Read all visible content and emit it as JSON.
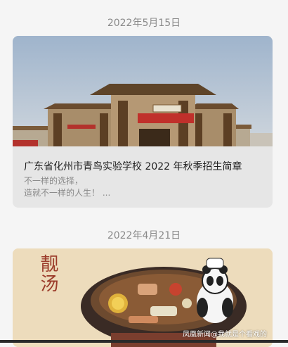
{
  "feed": {
    "items": [
      {
        "date": "2022年5月15日",
        "cover_icon": "school-gate-image",
        "title": "广东省化州市青鸟实验学校 2022 年秋季招生简章",
        "summary_lines": [
          "不一样的选择，",
          "造就不一样的人生！ ..."
        ]
      },
      {
        "date": "2022年4月21日",
        "cover_icon": "soup-pot-panda-image",
        "cover_text": "靓汤",
        "watermark": "凤凰新闻@我就是个看戏的"
      }
    ]
  }
}
